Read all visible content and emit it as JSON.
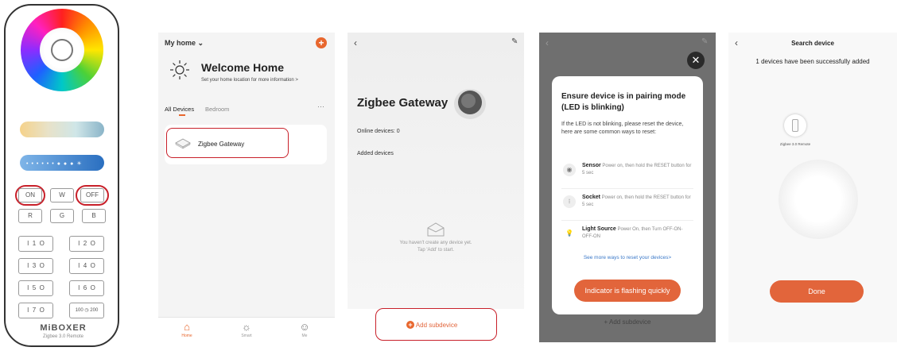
{
  "remote": {
    "buttons_row1": [
      "ON",
      "W",
      "OFF"
    ],
    "buttons_row2": [
      "R",
      "G",
      "B"
    ],
    "zones": [
      "1",
      "2",
      "3",
      "4",
      "5",
      "6",
      "7"
    ],
    "extra": [
      "100",
      "200"
    ],
    "brand": "MiBOXER",
    "model": "Zigbee 3.0 Remote"
  },
  "screen1": {
    "home_selector": "My home",
    "add_icon": "+",
    "welcome_title": "Welcome Home",
    "welcome_sub": "Set your home location for more information >",
    "tab_all": "All Devices",
    "tab_bedroom": "Bedroom",
    "more": "···",
    "device_name": "Zigbee Gateway",
    "tabs": [
      {
        "icon": "home-icon",
        "label": "Home"
      },
      {
        "icon": "sun-icon",
        "label": "Smart"
      },
      {
        "icon": "person-icon",
        "label": "Me"
      }
    ]
  },
  "screen2": {
    "title": "Zigbee Gateway",
    "online": "Online devices: 0",
    "added": "Added devices",
    "empty_line1": "You haven't create any device yet.",
    "empty_line2": "Tap 'Add' to start.",
    "add_button": "Add subdevice"
  },
  "screen3": {
    "modal_title_1": "Ensure device is in pairing mode",
    "modal_title_2": "(LED is blinking)",
    "modal_desc": "If the LED is not blinking, please reset the device, here are some common ways to reset:",
    "items": [
      {
        "name": "Sensor",
        "text": "Power on, then hold the RESET button for 5 sec"
      },
      {
        "name": "Socket",
        "text": "Power on, then hold the RESET button for 5 sec"
      },
      {
        "name": "Light Source",
        "text": "Power On, then Turn OFF-ON-OFF-ON"
      }
    ],
    "more_link": "See more ways to reset your devices>",
    "indicator_button": "Indicator is flashing quickly",
    "bg_add": "Add subdevice"
  },
  "screen4": {
    "title": "Search device",
    "status": "1 devices have been successfully added",
    "device_label": "Zigbee 3.0 Remote",
    "done_button": "Done"
  }
}
